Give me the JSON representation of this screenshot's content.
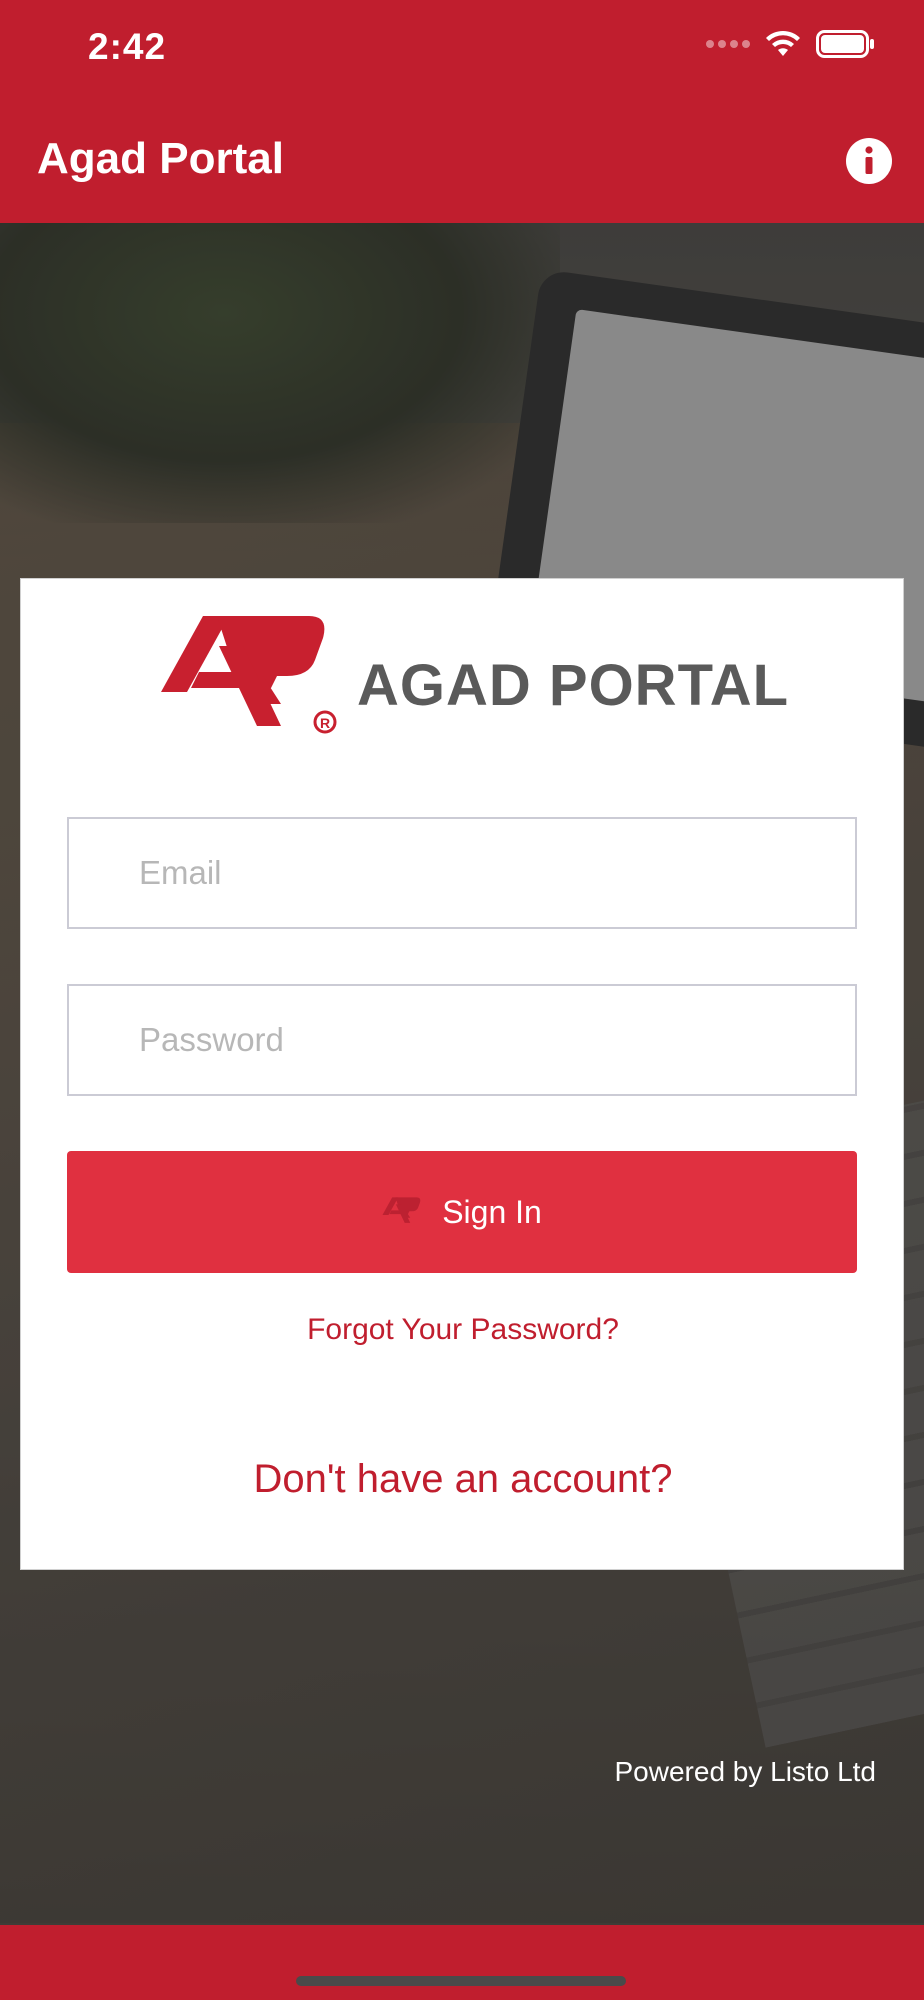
{
  "status_bar": {
    "time": "2:42",
    "icons": [
      "signal-icon",
      "wifi-icon",
      "battery-icon"
    ]
  },
  "nav": {
    "title": "Agad Portal",
    "info_icon": "info-icon"
  },
  "brand": {
    "logo_text": "AGAD PORTAL",
    "primary_color": "#c01e2e",
    "button_color": "#e03040"
  },
  "form": {
    "email_placeholder": "Email",
    "password_placeholder": "Password",
    "signin_label": "Sign In",
    "forgot_label": "Forgot Your Password?",
    "account_label": "Don't have an account?"
  },
  "footer": {
    "powered_by": "Powered by Listo Ltd"
  }
}
